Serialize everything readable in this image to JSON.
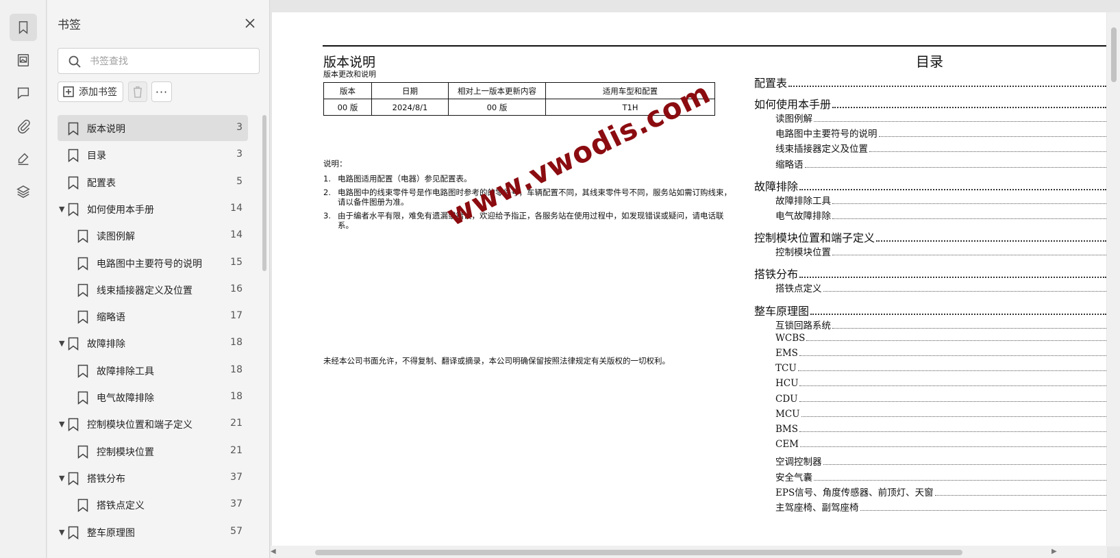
{
  "rail": {
    "items": [
      {
        "name": "bookmark-icon",
        "active": true
      },
      {
        "name": "image-icon",
        "active": false
      },
      {
        "name": "comment-icon",
        "active": false
      },
      {
        "name": "paperclip-icon",
        "active": false
      },
      {
        "name": "signature-icon",
        "active": false
      },
      {
        "name": "layers-icon",
        "active": false
      }
    ]
  },
  "panel": {
    "title": "书签",
    "search_placeholder": "书签查找",
    "add_label": "添加书签",
    "more_label": "···"
  },
  "bookmarks": [
    {
      "label": "版本说明",
      "page": "3",
      "level": 0,
      "arrow": false,
      "selected": true
    },
    {
      "label": "目录",
      "page": "3",
      "level": 0,
      "arrow": false
    },
    {
      "label": "配置表",
      "page": "5",
      "level": 0,
      "arrow": false
    },
    {
      "label": "如何使用本手册",
      "page": "14",
      "level": 0,
      "arrow": true
    },
    {
      "label": "读图例解",
      "page": "14",
      "level": 1,
      "arrow": false
    },
    {
      "label": "电路图中主要符号的说明",
      "page": "15",
      "level": 1,
      "arrow": false
    },
    {
      "label": "线束插接器定义及位置",
      "page": "16",
      "level": 1,
      "arrow": false
    },
    {
      "label": "缩略语",
      "page": "17",
      "level": 1,
      "arrow": false
    },
    {
      "label": "故障排除",
      "page": "18",
      "level": 0,
      "arrow": true
    },
    {
      "label": "故障排除工具",
      "page": "18",
      "level": 1,
      "arrow": false
    },
    {
      "label": "电气故障排除",
      "page": "18",
      "level": 1,
      "arrow": false
    },
    {
      "label": "控制模块位置和端子定义",
      "page": "21",
      "level": 0,
      "arrow": true
    },
    {
      "label": "控制模块位置",
      "page": "21",
      "level": 1,
      "arrow": false
    },
    {
      "label": "搭铁分布",
      "page": "37",
      "level": 0,
      "arrow": true
    },
    {
      "label": "搭铁点定义",
      "page": "37",
      "level": 1,
      "arrow": false
    },
    {
      "label": "整车原理图",
      "page": "57",
      "level": 0,
      "arrow": true
    }
  ],
  "doc": {
    "title": "版本说明",
    "subtitle": "版本更改和说明",
    "table": {
      "headers": [
        "版本",
        "日期",
        "相对上一版本更新内容",
        "适用车型和配置"
      ],
      "row": [
        "00 版",
        "2024/8/1",
        "00 版",
        "T1H"
      ]
    },
    "notes_head": "说明：",
    "notes": [
      {
        "num": "1.",
        "text": "电路图适用配置（电器）参见配置表。"
      },
      {
        "num": "2.",
        "text": "电路图中的线束零件号是作电路图时参考的的零件号，车辆配置不同，其线束零件号不同，服务站如需订购线束，请以备件图册为准。"
      },
      {
        "num": "3.",
        "text": "由于编者水平有限，难免有遗漏或错误，欢迎给予指正，各服务站在使用过程中，如发现错误或疑问，请电话联系。"
      }
    ],
    "copyright": "未经本公司书面允许，不得复制、翻译或摘录，本公司明确保留按照法律规定有关版权的一切权利。",
    "watermark": "www.vwodis.com",
    "toc_title": "目录",
    "toc": [
      {
        "label": "配置表",
        "level": 1
      },
      {
        "label": "如何使用本手册",
        "level": 1
      },
      {
        "label": "读图例解",
        "level": 2
      },
      {
        "label": "电路图中主要符号的说明",
        "level": 2
      },
      {
        "label": "线束插接器定义及位置",
        "level": 2
      },
      {
        "label": "缩略语",
        "level": 2
      },
      {
        "label": "故障排除",
        "level": 1
      },
      {
        "label": "故障排除工具",
        "level": 2
      },
      {
        "label": "电气故障排除",
        "level": 2
      },
      {
        "label": "控制模块位置和端子定义",
        "level": 1
      },
      {
        "label": "控制模块位置",
        "level": 2
      },
      {
        "label": "搭铁分布",
        "level": 1
      },
      {
        "label": "搭铁点定义",
        "level": 2
      },
      {
        "label": "整车原理图",
        "level": 1
      },
      {
        "label": "互锁回路系统",
        "level": 2
      },
      {
        "label": "WCBS",
        "level": 2
      },
      {
        "label": "EMS",
        "level": 2
      },
      {
        "label": "TCU",
        "level": 2
      },
      {
        "label": "HCU",
        "level": 2
      },
      {
        "label": "CDU",
        "level": 2
      },
      {
        "label": "MCU",
        "level": 2
      },
      {
        "label": "BMS",
        "level": 2
      },
      {
        "label": "CEM",
        "level": 2
      },
      {
        "label": "空调控制器",
        "level": 2
      },
      {
        "label": "安全气囊",
        "level": 2
      },
      {
        "label": "EPS信号、角度传感器、前顶灯、天窗",
        "level": 2
      },
      {
        "label": "主驾座椅、副驾座椅",
        "level": 2
      }
    ]
  }
}
